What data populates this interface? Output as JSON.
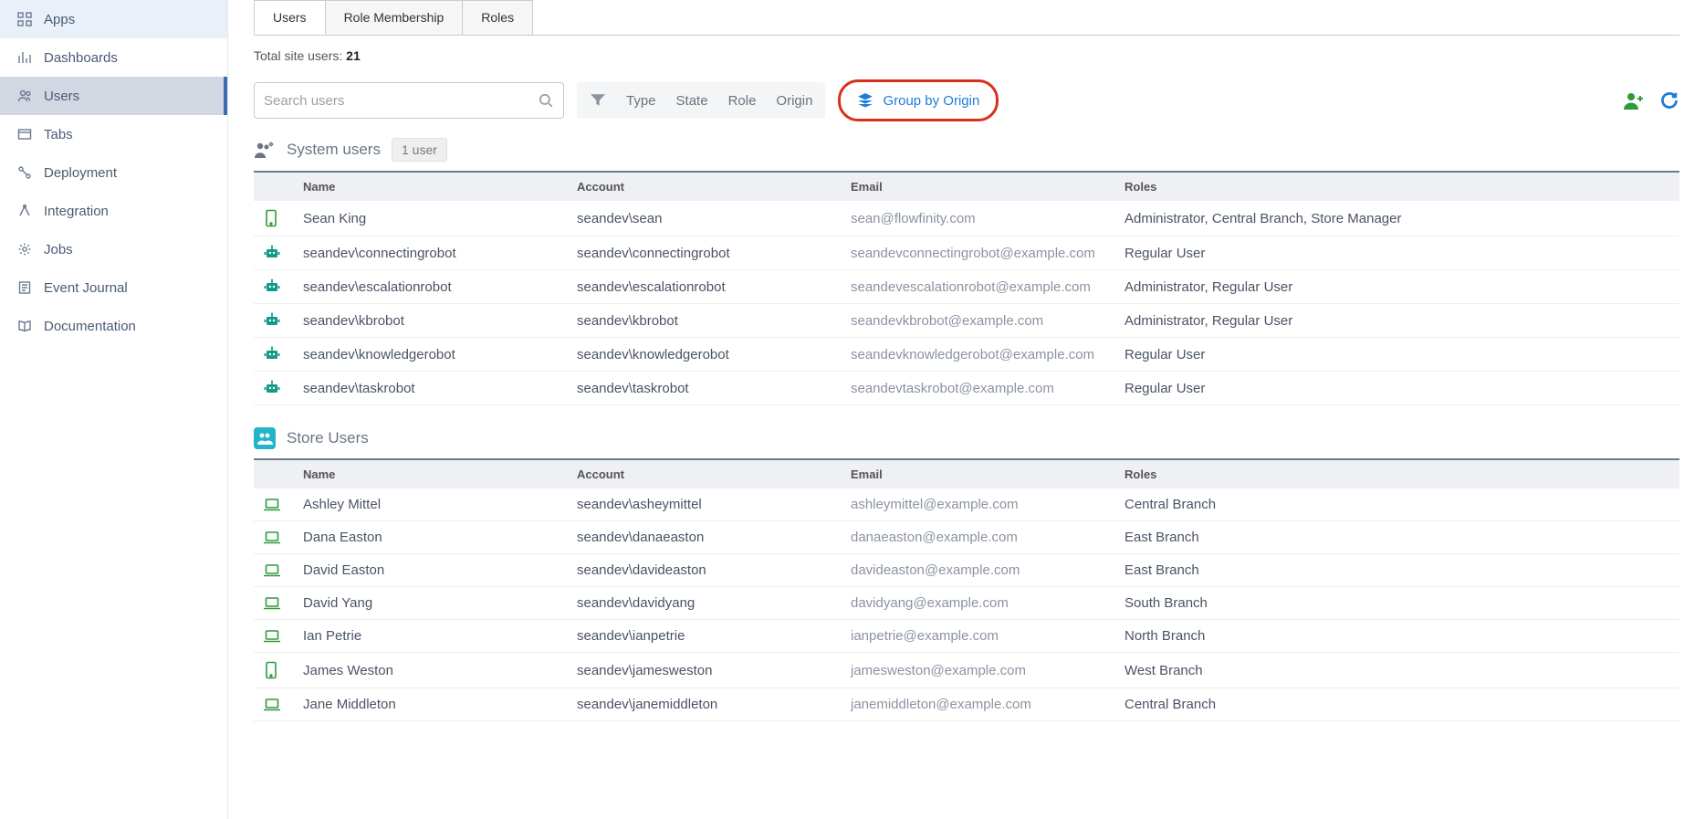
{
  "sidebar": {
    "items": [
      {
        "label": "Apps",
        "icon": "grid"
      },
      {
        "label": "Dashboards",
        "icon": "chart"
      },
      {
        "label": "Users",
        "icon": "users"
      },
      {
        "label": "Tabs",
        "icon": "tabs"
      },
      {
        "label": "Deployment",
        "icon": "deploy"
      },
      {
        "label": "Integration",
        "icon": "integration"
      },
      {
        "label": "Jobs",
        "icon": "gear"
      },
      {
        "label": "Event Journal",
        "icon": "journal"
      },
      {
        "label": "Documentation",
        "icon": "book"
      }
    ],
    "highlightedIndex": 0,
    "activeIndex": 2
  },
  "tabs": {
    "items": [
      {
        "label": "Users"
      },
      {
        "label": "Role Membership"
      },
      {
        "label": "Roles"
      }
    ],
    "activeIndex": 0
  },
  "summary": {
    "prefix": "Total site users: ",
    "count": "21"
  },
  "toolbar": {
    "searchPlaceholder": "Search users",
    "filters": [
      "Type",
      "State",
      "Role",
      "Origin"
    ],
    "groupByOrigin": "Group by Origin"
  },
  "groups": [
    {
      "title": "System users",
      "badge": "1 user",
      "style": "system",
      "columns": [
        "Name",
        "Account",
        "Email",
        "Roles"
      ],
      "rows": [
        {
          "icon": "mobile",
          "name": "Sean King",
          "account": "seandev\\sean",
          "email": "sean@flowfinity.com",
          "roles": "Administrator, Central Branch, Store Manager"
        },
        {
          "icon": "robot",
          "name": "seandev\\connectingrobot",
          "account": "seandev\\connectingrobot",
          "email": "seandevconnectingrobot@example.com",
          "roles": "Regular User"
        },
        {
          "icon": "robot",
          "name": "seandev\\escalationrobot",
          "account": "seandev\\escalationrobot",
          "email": "seandevescalationrobot@example.com",
          "roles": "Administrator, Regular User"
        },
        {
          "icon": "robot",
          "name": "seandev\\kbrobot",
          "account": "seandev\\kbrobot",
          "email": "seandevkbrobot@example.com",
          "roles": "Administrator, Regular User"
        },
        {
          "icon": "robot",
          "name": "seandev\\knowledgerobot",
          "account": "seandev\\knowledgerobot",
          "email": "seandevknowledgerobot@example.com",
          "roles": "Regular User"
        },
        {
          "icon": "robot",
          "name": "seandev\\taskrobot",
          "account": "seandev\\taskrobot",
          "email": "seandevtaskrobot@example.com",
          "roles": "Regular User"
        }
      ]
    },
    {
      "title": "Store Users",
      "badge": "",
      "style": "store",
      "columns": [
        "Name",
        "Account",
        "Email",
        "Roles"
      ],
      "rows": [
        {
          "icon": "laptop",
          "name": "Ashley Mittel",
          "account": "seandev\\asheymittel",
          "email": "ashleymittel@example.com",
          "roles": "Central Branch"
        },
        {
          "icon": "laptop",
          "name": "Dana Easton",
          "account": "seandev\\danaeaston",
          "email": "danaeaston@example.com",
          "roles": "East Branch"
        },
        {
          "icon": "laptop",
          "name": "David Easton",
          "account": "seandev\\davideaston",
          "email": "davideaston@example.com",
          "roles": "East Branch"
        },
        {
          "icon": "laptop",
          "name": "David Yang",
          "account": "seandev\\davidyang",
          "email": "davidyang@example.com",
          "roles": "South Branch"
        },
        {
          "icon": "laptop",
          "name": "Ian Petrie",
          "account": "seandev\\ianpetrie",
          "email": "ianpetrie@example.com",
          "roles": "North Branch"
        },
        {
          "icon": "mobile",
          "name": "James Weston",
          "account": "seandev\\jamesweston",
          "email": "jamesweston@example.com",
          "roles": "West Branch"
        },
        {
          "icon": "laptop",
          "name": "Jane Middleton",
          "account": "seandev\\janemiddleton",
          "email": "janemiddleton@example.com",
          "roles": "Central Branch"
        }
      ]
    }
  ]
}
